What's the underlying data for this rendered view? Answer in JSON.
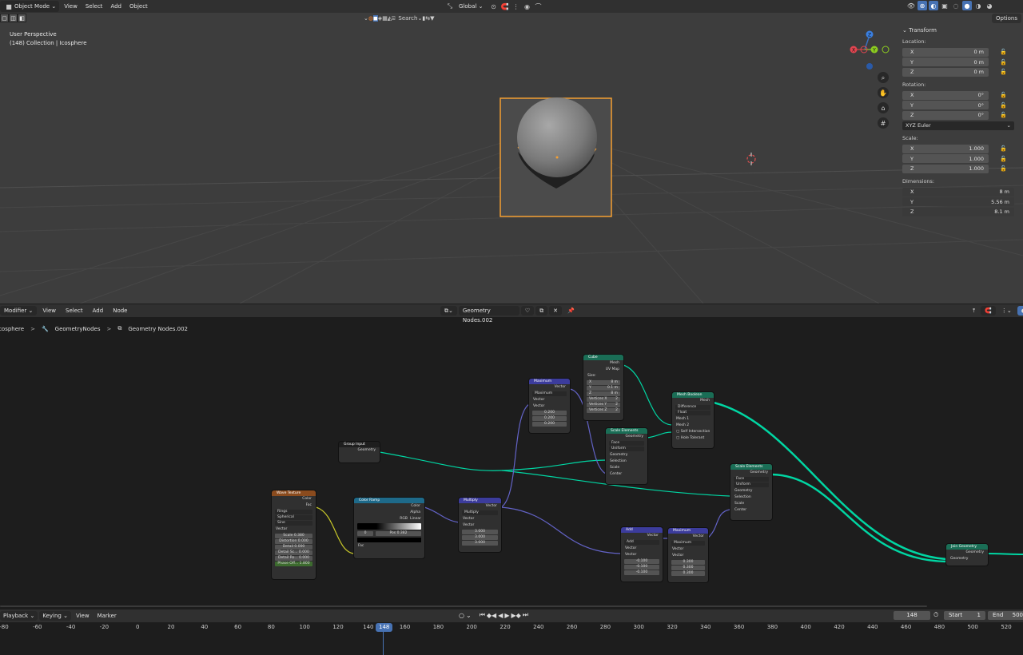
{
  "viewport": {
    "header": {
      "mode": "Object Mode",
      "menus": [
        "View",
        "Select",
        "Add",
        "Object"
      ],
      "transform_orientation": "Global",
      "search_placeholder": "Search",
      "options": "Options"
    },
    "info_line1": "User Perspective",
    "info_line2": "(148) Collection | Icosphere",
    "gizmo": {
      "z": "Z",
      "y": "Y",
      "x": "X"
    },
    "colors": {
      "background": "#3d3d3d",
      "selection": "#f5a033",
      "accent": "#4772b3"
    }
  },
  "npanel": {
    "section": "Transform",
    "location_label": "Location:",
    "location": [
      {
        "axis": "X",
        "value": "0 m"
      },
      {
        "axis": "Y",
        "value": "0 m"
      },
      {
        "axis": "Z",
        "value": "0 m"
      }
    ],
    "rotation_label": "Rotation:",
    "rotation": [
      {
        "axis": "X",
        "value": "0°"
      },
      {
        "axis": "Y",
        "value": "0°"
      },
      {
        "axis": "Z",
        "value": "0°"
      }
    ],
    "rotation_mode": "XYZ Euler",
    "scale_label": "Scale:",
    "scale": [
      {
        "axis": "X",
        "value": "1.000"
      },
      {
        "axis": "Y",
        "value": "1.000"
      },
      {
        "axis": "Z",
        "value": "1.000"
      }
    ],
    "dimensions_label": "Dimensions:",
    "dimensions": [
      {
        "axis": "X",
        "value": "8 m"
      },
      {
        "axis": "Y",
        "value": "5.56 m"
      },
      {
        "axis": "Z",
        "value": "8.1 m"
      }
    ]
  },
  "node_editor": {
    "header": {
      "editor_type": "Modifier",
      "menus": [
        "View",
        "Select",
        "Add",
        "Node"
      ],
      "tree_name": "Geometry Nodes.002"
    },
    "breadcrumb": [
      "Icosphere",
      "GeometryNodes",
      "Geometry Nodes.002"
    ],
    "nodes": {
      "group_input": {
        "title": "Group Input",
        "out1": "Geometry"
      },
      "wave": {
        "title": "Wave Texture",
        "out1": "Color",
        "out2": "Fac",
        "opt1": "Rings",
        "opt2": "Spherical",
        "opt3": "Sine",
        "in_vector": "Vector",
        "fields": [
          {
            "k": "Scale",
            "v": "0.380"
          },
          {
            "k": "Distortion",
            "v": "0.000"
          },
          {
            "k": "Detail",
            "v": "0.000"
          },
          {
            "k": "Detail Sc...",
            "v": "0.000"
          },
          {
            "k": "Detail Ro...",
            "v": "0.000"
          },
          {
            "k": "Phase Off...",
            "v": "1.800"
          }
        ]
      },
      "ramp": {
        "title": "Color Ramp",
        "out1": "Color",
        "out2": "Alpha",
        "mode": "RGB",
        "interp": "Linear",
        "idx": "0",
        "pos_label": "Pos",
        "pos": "0.382",
        "in1": "Fac"
      },
      "multiply": {
        "title": "Multiply",
        "out1": "Vector",
        "op": "Multiply",
        "in1": "Vector",
        "in2": "Vector",
        "v1": "3.000",
        "v2": "3.000",
        "v3": "3.000"
      },
      "max1": {
        "title": "Maximum",
        "out1": "Vector",
        "op": "Maximum",
        "in1": "Vector",
        "in2": "Vector",
        "v1": "0.200",
        "v2": "0.200",
        "v3": "0.200"
      },
      "cube": {
        "title": "Cube",
        "out1": "Mesh",
        "out2": "UV Map",
        "size_label": "Size:",
        "fields": [
          {
            "k": "X",
            "v": "8 m"
          },
          {
            "k": "Y",
            "v": "0.1 m"
          },
          {
            "k": "Z",
            "v": "8 m"
          },
          {
            "k": "Vertices X",
            "v": "2"
          },
          {
            "k": "Vertices Y",
            "v": "2"
          },
          {
            "k": "Vertices Z",
            "v": "2"
          }
        ]
      },
      "scale1": {
        "title": "Scale Elements",
        "out1": "Geometry",
        "d1": "Face",
        "d2": "Uniform",
        "in1": "Geometry",
        "in2": "Selection",
        "in3": "Scale",
        "in4": "Center"
      },
      "boolean": {
        "title": "Mesh Boolean",
        "out1": "Mesh",
        "d1": "Difference",
        "d2": "Float",
        "in1": "Mesh 1",
        "in2": "Mesh 2",
        "c1": "Self Intersection",
        "c2": "Hole Tolerant"
      },
      "scale2": {
        "title": "Scale Elements",
        "out1": "Geometry",
        "d1": "Face",
        "d2": "Uniform",
        "in1": "Geometry",
        "in2": "Selection",
        "in3": "Scale",
        "in4": "Center"
      },
      "add": {
        "title": "Add",
        "out1": "Vector",
        "op": "Add",
        "in1": "Vector",
        "in2": "Vector",
        "v1": "-0.100",
        "v2": "-0.100",
        "v3": "-0.100"
      },
      "max2": {
        "title": "Maximum",
        "out1": "Vector",
        "op": "Maximum",
        "in1": "Vector",
        "in2": "Vector",
        "v1": "0.300",
        "v2": "0.300",
        "v3": "0.300"
      },
      "join": {
        "title": "Join Geometry",
        "out1": "Geometry",
        "in1": "Geometry"
      }
    },
    "header_colors": {
      "input": "#1e1e1e",
      "texture": "#8a4b1e",
      "converter": "#1e6a8a",
      "vector": "#3c3c9c",
      "geometry": "#1a6e56"
    }
  },
  "timeline": {
    "menus": [
      "Playback",
      "Keying",
      "View",
      "Marker"
    ],
    "current_frame": "148",
    "start_label": "Start",
    "start": "1",
    "end_label": "End",
    "end": "500",
    "ticks": [
      "-80",
      "-60",
      "-40",
      "-20",
      "0",
      "20",
      "40",
      "60",
      "80",
      "100",
      "120",
      "140",
      "160",
      "180",
      "200",
      "220",
      "240",
      "260",
      "280",
      "300",
      "320",
      "340",
      "360",
      "380",
      "400",
      "420",
      "440",
      "460",
      "480",
      "500",
      "520"
    ]
  }
}
